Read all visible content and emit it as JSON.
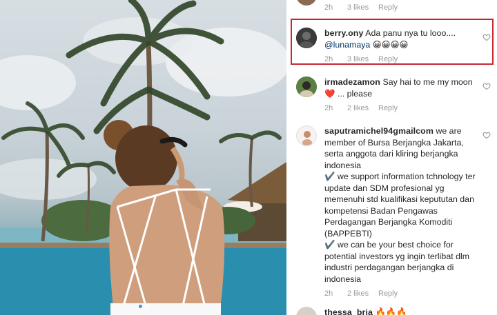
{
  "post": {
    "carousel_total": 2,
    "carousel_active": 1
  },
  "comments": [
    {
      "id": "c0",
      "username": "",
      "text": "",
      "time": "2h",
      "likes": "3 likes",
      "reply": "Reply"
    },
    {
      "id": "c1",
      "username": "berry.ony",
      "text": "Ada panu nya tu looo....",
      "mention": "@lunamaya",
      "emoji": "😀😀😀😀",
      "time": "2h",
      "likes": "3 likes",
      "reply": "Reply",
      "highlighted": true,
      "highlight_color": "#c8282d"
    },
    {
      "id": "c2",
      "username": "irmadezamon",
      "text": "Say hai to me my moon",
      "heart_emoji": "❤️",
      "text_after": " ... please",
      "time": "2h",
      "likes": "2 likes",
      "reply": "Reply"
    },
    {
      "id": "c3",
      "username": "saputramichel94gmailcom",
      "text_p1": "we are member of Bursa Berjangka Jakarta, serta anggota dari kliring berjangka indonesia",
      "text_p2": "✔️ we support information tchnology ter update dan SDM profesional yg memenuhi std kualifikasi kepututan dan kompetensi Badan Pengawas Perdagangan Berjangka Komoditi (BAPPEBTI)",
      "text_p3": "✔️ we can be your best choice for potential investors yg ingin terlibat dlm industri perdagangan berjangka di indonesia",
      "time": "2h",
      "likes": "2 likes",
      "reply": "Reply"
    },
    {
      "id": "c4",
      "username": "thessa_bria",
      "text": "🔥🔥🔥"
    }
  ],
  "colors": {
    "meta_text": "#999999",
    "mention": "#003569",
    "carousel_active_dot": "#3897f0"
  }
}
